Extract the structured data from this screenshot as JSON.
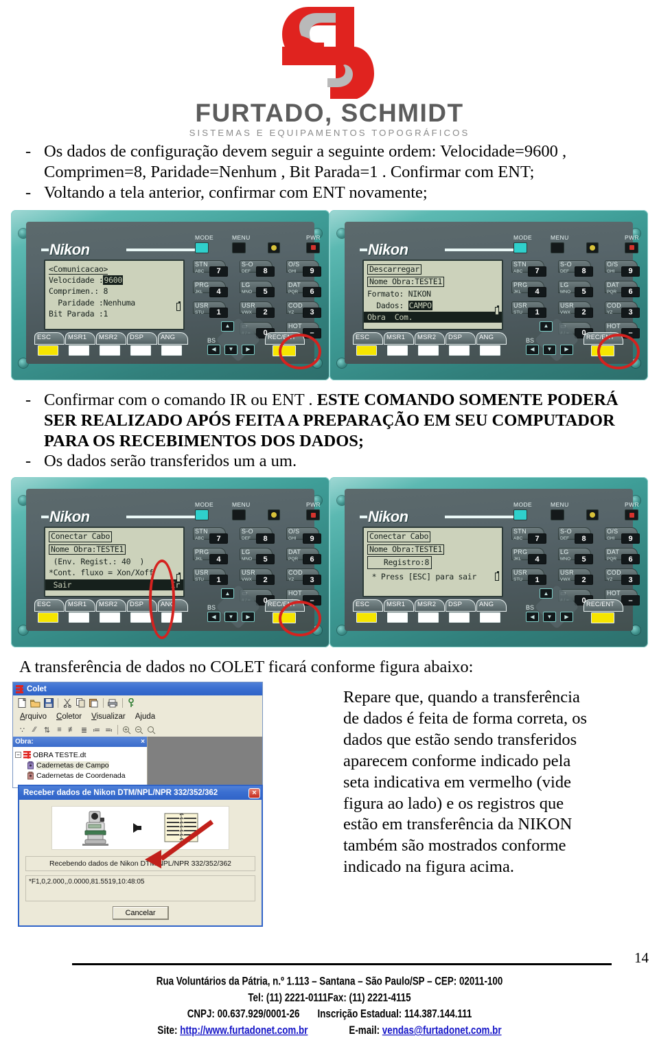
{
  "brand": {
    "logo_icon": "fs-monogram-logo",
    "wordmark": "FURTADO, SCHMIDT",
    "tagline": "SISTEMAS E EQUIPAMENTOS TOPOGRÁFICOS",
    "red": "#e0231f",
    "grey": "#b9b9b9"
  },
  "body": {
    "bullet1_line1": "Os dados de configuração devem seguir a seguinte ordem: Velocidade=9600 ,",
    "bullet1_line2": "Comprimen=8, Paridade=Nenhum , Bit Parada=1 . Confirmar com ENT;",
    "bullet2": "Voltando a tela anterior, confirmar com ENT novamente;",
    "bullet3_normal": "Confirmar com o comando IR ou ENT . ",
    "bullet3_caps": "ESTE COMANDO SOMENTE PODERÁ SER REALIZADO APÓS FEITA A PREPARAÇÃO EM SEU COMPUTADOR PARA OS RECEBIMENTOS DOS DADOS;",
    "bullet4": "Os dados serão transferidos um a um.",
    "intro_colet": "A transferência de dados no COLET ficará conforme figura abaixo:",
    "dash": "-"
  },
  "sidenote": {
    "text": "Repare que, quando a transferência de dados é feita de forma correta, os dados que estão sendo transferidos aparecem conforme indicado pela seta indicativa em vermelho (vide figura ao lado) e os registros que estão em transferência da NIKON também são mostrados conforme indicado na figura acima."
  },
  "devices": [
    {
      "id": "device-comunicacao",
      "brand": "Nikon",
      "screen": {
        "title": "<Comunicacao>",
        "rows": [
          {
            "label": "Velocidade :",
            "value": "9600",
            "highlight": true
          },
          {
            "label": "Comprimen.: ",
            "value": "8",
            "highlight": false
          },
          {
            "label": "  Paridade :",
            "value": "Nenhuma",
            "highlight": false
          },
          {
            "label": "Bit Parada :",
            "value": "1",
            "highlight": false
          }
        ],
        "bottom_bar": ""
      },
      "highlight_key": "REC/ENT"
    },
    {
      "id": "device-descarregar",
      "brand": "Nikon",
      "screen": {
        "title": "Descarregar",
        "rows": [
          {
            "label": "Nome Obra:",
            "value": "TESTE1",
            "boxed": true
          },
          {
            "label": "Formato: ",
            "value": "NIKON",
            "highlight": false
          },
          {
            "label": "  Dados: ",
            "value": "CAMPO",
            "highlight": true
          }
        ],
        "bottom_bar": "Obra  Com."
      },
      "highlight_key": "REC/ENT"
    },
    {
      "id": "device-conectar-cabo-ir",
      "brand": "Nikon",
      "screen": {
        "title": "Conectar Cabo",
        "rows": [
          {
            "label": "Nome Obra:",
            "value": "TESTE1",
            "boxed": true
          },
          {
            "label": " (Env. Regist.: 40  )",
            "value": "",
            "highlight": false
          },
          {
            "label": "*Cont. fluxo = Xon/Xoff",
            "value": "",
            "highlight": false
          }
        ],
        "bottom_bar_left": " Sair",
        "bottom_bar_right": "Ir"
      },
      "highlight_key": "ANG and REC/ENT"
    },
    {
      "id": "device-registro",
      "brand": "Nikon",
      "screen": {
        "title": "Conectar Cabo",
        "rows": [
          {
            "label": "Nome Obra:",
            "value": "TESTE1",
            "boxed": true
          },
          {
            "label": "   Registro:",
            "value": "8",
            "boxed2": true
          },
          {
            "label": " * Press [ESC] para sair",
            "value": "",
            "highlight": false
          }
        ],
        "bottom_bar": ""
      },
      "highlight_key": ""
    }
  ],
  "keypad": {
    "top_labels": [
      "MODE",
      "MENU",
      "PWR"
    ],
    "keys": [
      {
        "name": "STN",
        "sub": "ABC",
        "num": "7"
      },
      {
        "name": "S-O",
        "sub": "DEF",
        "num": "8"
      },
      {
        "name": "O/S",
        "sub": "GHI",
        "num": "9"
      },
      {
        "name": "PRG",
        "sub": "JKL",
        "num": "4"
      },
      {
        "name": "LG",
        "sub": "MNO",
        "num": "5"
      },
      {
        "name": "DAT",
        "sub": "PQR",
        "num": "6"
      },
      {
        "name": "USR",
        "sub": "STU",
        "num": "1"
      },
      {
        "name": "USR",
        "sub": "VWX",
        "num": "2"
      },
      {
        "name": "COD",
        "sub": "YZ",
        "num": "3"
      },
      {
        "name": "▭",
        "sub": "# / =",
        "num": "0"
      },
      {
        "name": "HOT",
        "sub": "- +",
        "num": "–"
      }
    ],
    "softkeys": [
      "ESC",
      "MSR1",
      "MSR2",
      "DSP",
      "ANG"
    ],
    "enter_key": "REC/ENT",
    "bs_label": "BS",
    "arrows": [
      "◀",
      "▼",
      "▶",
      "▲"
    ]
  },
  "colet": {
    "window_title": "Colet",
    "toolbar_icons": [
      "new-file-icon",
      "open-folder-icon",
      "save-disk-icon",
      "cut-scissors-icon",
      "copy-icon",
      "paste-icon",
      "print-icon",
      "help-key-icon"
    ],
    "menu": [
      {
        "label": "Arquivo",
        "accel": "A"
      },
      {
        "label": "Coletor",
        "accel": "C"
      },
      {
        "label": "Visualizar",
        "accel": "V"
      },
      {
        "label": "Ajuda",
        "accel": "j"
      }
    ],
    "toolbar2_icons": [
      "calc-icon",
      "line-icon",
      "updown-icon",
      "align1-icon",
      "align2-icon",
      "align3-icon",
      "xy1-icon",
      "xy2-icon",
      "zoom-in-icon",
      "zoom-out-icon",
      "zoom-fit-icon"
    ],
    "tree_panel_title": "Obra:",
    "tree_close": "×",
    "tree": {
      "root": "OBRA TESTE.dt",
      "children": [
        "Cadernetas de Campo",
        "Cadernetas de Coordenada"
      ]
    },
    "dialog": {
      "title": "Receber dados de Nikon DTM/NPL/NPR 332/352/362",
      "close": "×",
      "status": "Recebendo dados de Nikon DTM/NPL/NPR 332/352/362",
      "data_line": "*F1,0,2.000,,0.0000,81.5519,10:48:05",
      "cancel_label": "Cancelar",
      "arrow_color": "#c1201a"
    }
  },
  "footer": {
    "page_number": "14",
    "line1": "Rua Voluntários da Pátria, n.º 1.113 – Santana – São Paulo/SP – CEP: 02011-100",
    "line2": "Tel: (11) 2221-0111Fax: (11) 2221-4115",
    "line3_a": "CNPJ: 00.637.929/0001-26",
    "line3_b": "Inscrição Estadual: 114.387.144.111",
    "line4_site_label": "Site:",
    "line4_site_url": "http://www.furtadonet.com.br",
    "line4_email_label": "E-mail:",
    "line4_email": "vendas@furtadonet.com.br"
  }
}
